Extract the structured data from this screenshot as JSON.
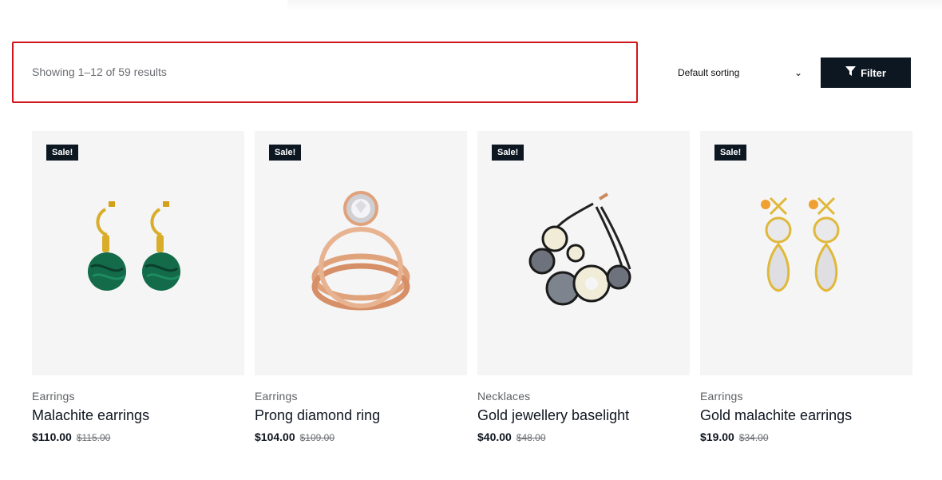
{
  "toolbar": {
    "result_count": "Showing 1–12 of 59 results",
    "sorting_value": "Default sorting",
    "filter_label": "Filter"
  },
  "colors": {
    "highlight": "#d0161b",
    "dark": "#0c1722",
    "card_bg": "#f5f5f5"
  },
  "products": [
    {
      "badge": "Sale!",
      "category": "Earrings",
      "title": "Malachite earrings",
      "price": "$110.00",
      "old_price": "$115.00",
      "image": "malachite-earrings"
    },
    {
      "badge": "Sale!",
      "category": "Earrings",
      "title": "Prong diamond ring",
      "price": "$104.00",
      "old_price": "$109.00",
      "image": "diamond-ring"
    },
    {
      "badge": "Sale!",
      "category": "Necklaces",
      "title": "Gold jewellery baselight",
      "price": "$40.00",
      "old_price": "$48.00",
      "image": "bracelet"
    },
    {
      "badge": "Sale!",
      "category": "Earrings",
      "title": "Gold malachite earrings",
      "price": "$19.00",
      "old_price": "$34.00",
      "image": "crystal-earrings"
    }
  ]
}
